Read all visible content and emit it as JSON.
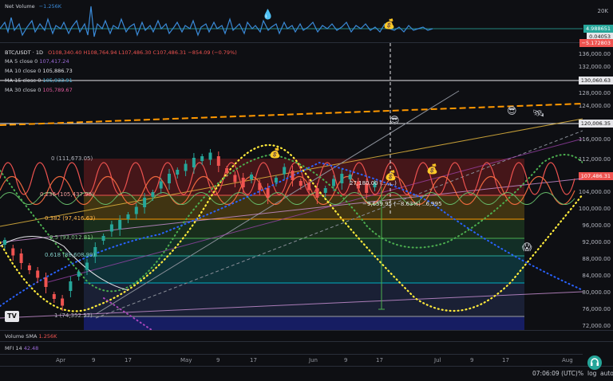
{
  "net_volume": {
    "label": "Net Volume",
    "value": "−1.256K",
    "scale": "20K",
    "tags": [
      "4.988651",
      "0.04053",
      "−5.172803"
    ]
  },
  "symbol": {
    "label": "BTC/USDT · 1D",
    "ohlc": "O108,340.40  H108,764.94  L107,486.30  C107,486.31  −854.09 (−0.79%)"
  },
  "ma": [
    {
      "label": "MA 5 close 0",
      "value": "107,417.24",
      "color": "#9c6ad8"
    },
    {
      "label": "MA 10 close 0",
      "value": "105,886.73",
      "color": "#e6e6ea"
    },
    {
      "label": "MA 15 close 0",
      "value": "105,933.91",
      "color": "#4bb0d8"
    },
    {
      "label": "MA 30 close 0",
      "value": "105,789.67",
      "color": "#e05a9c"
    }
  ],
  "price_axis": [
    "136,000.00",
    "132,000.00",
    "128,000.00",
    "124,000.00",
    "116,000.00",
    "112,000.00",
    "108,000.00",
    "104,000.00",
    "100,000.00",
    "96,000.00",
    "92,000.00",
    "88,000.00",
    "84,000.00",
    "80,000.00",
    "76,000.00",
    "72,000.00"
  ],
  "price_tags": {
    "top": "130,060.63",
    "mid": "120,006.35",
    "current": "107,486.31"
  },
  "fib": [
    "0 (111,673.05)",
    "0.236 (105,437.98)",
    "0.382 (97,416.63)",
    "0.5 (93,012.81)",
    "0.618 (88,608.99)",
    "1 (74,352.57)"
  ],
  "measure": {
    "top": "27,180.00 (...,...)",
    "bottom": "−9,659.95 (−8.63%) ..6,995"
  },
  "volume_sma": {
    "label": "Volume SMA",
    "value": "1.256K"
  },
  "mfi": {
    "label": "MFI 14",
    "value": "42.48"
  },
  "x_axis": [
    "Apr",
    "9",
    "17",
    "May",
    "9",
    "17",
    "Jun",
    "9",
    "17",
    "Jul",
    "9",
    "17",
    "Aug"
  ],
  "footer": {
    "time": "07:06:09 (UTC)",
    "percent": "%",
    "log": "log",
    "auto": "auto"
  },
  "logo": "TV",
  "colors": {
    "bg": "#0e0f13",
    "accent": "#2962ff",
    "green": "#26a69a",
    "red": "#ef5350",
    "orange": "#ff9800",
    "fib_green": "#00c853",
    "volume_line": "#3a8ad8"
  },
  "icons": [
    "droplet-icon",
    "money-bag-icon",
    "cool-face-icon",
    "satellite-icon",
    "scream-icon",
    "headset-icon"
  ]
}
